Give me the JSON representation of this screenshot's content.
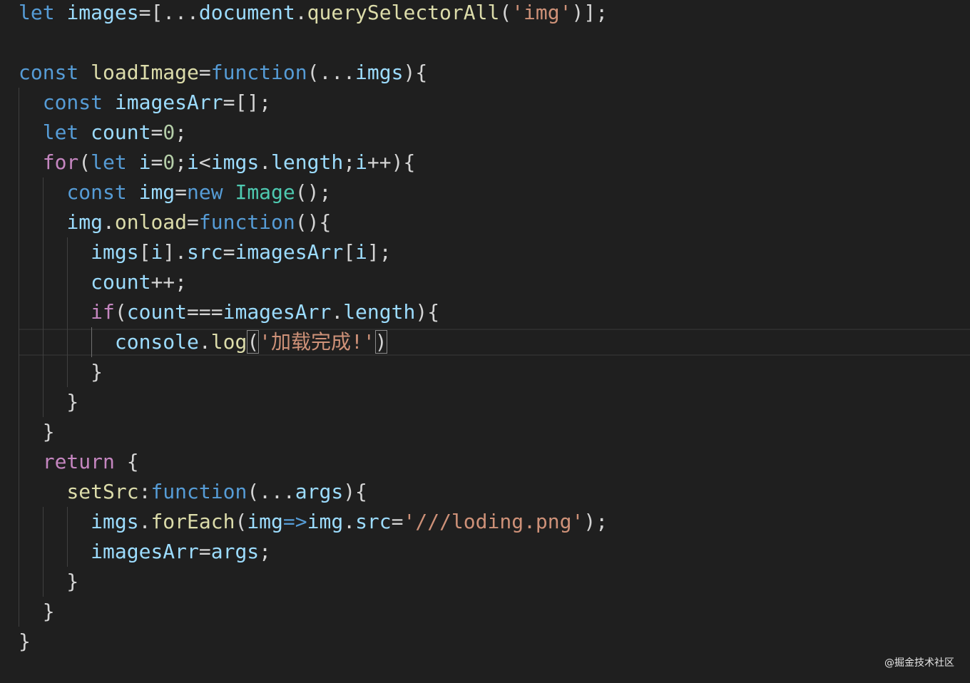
{
  "editor": {
    "lines": [
      [
        [
          "kw",
          "let"
        ],
        [
          "txt",
          " "
        ],
        [
          "var",
          "images"
        ],
        [
          "txt",
          "=[..."
        ],
        [
          "var",
          "document"
        ],
        [
          "txt",
          "."
        ],
        [
          "fn",
          "querySelectorAll"
        ],
        [
          "txt",
          "("
        ],
        [
          "str",
          "'img'"
        ],
        [
          "txt",
          ")];"
        ]
      ],
      [],
      [
        [
          "kw",
          "const"
        ],
        [
          "txt",
          " "
        ],
        [
          "fn",
          "loadImage"
        ],
        [
          "txt",
          "="
        ],
        [
          "kw",
          "function"
        ],
        [
          "txt",
          "(..."
        ],
        [
          "var",
          "imgs"
        ],
        [
          "txt",
          "){"
        ]
      ],
      [
        [
          "txt",
          "  "
        ],
        [
          "kw",
          "const"
        ],
        [
          "txt",
          " "
        ],
        [
          "var",
          "imagesArr"
        ],
        [
          "txt",
          "=[];"
        ]
      ],
      [
        [
          "txt",
          "  "
        ],
        [
          "kw",
          "let"
        ],
        [
          "txt",
          " "
        ],
        [
          "var",
          "count"
        ],
        [
          "txt",
          "="
        ],
        [
          "num",
          "0"
        ],
        [
          "txt",
          ";"
        ]
      ],
      [
        [
          "txt",
          "  "
        ],
        [
          "ctl",
          "for"
        ],
        [
          "txt",
          "("
        ],
        [
          "kw",
          "let"
        ],
        [
          "txt",
          " "
        ],
        [
          "var",
          "i"
        ],
        [
          "txt",
          "="
        ],
        [
          "num",
          "0"
        ],
        [
          "txt",
          ";"
        ],
        [
          "var",
          "i"
        ],
        [
          "txt",
          "<"
        ],
        [
          "var",
          "imgs"
        ],
        [
          "txt",
          "."
        ],
        [
          "var",
          "length"
        ],
        [
          "txt",
          ";"
        ],
        [
          "var",
          "i"
        ],
        [
          "txt",
          "++){"
        ]
      ],
      [
        [
          "txt",
          "    "
        ],
        [
          "kw",
          "const"
        ],
        [
          "txt",
          " "
        ],
        [
          "var",
          "img"
        ],
        [
          "txt",
          "="
        ],
        [
          "kw",
          "new"
        ],
        [
          "txt",
          " "
        ],
        [
          "cls",
          "Image"
        ],
        [
          "txt",
          "();"
        ]
      ],
      [
        [
          "txt",
          "    "
        ],
        [
          "var",
          "img"
        ],
        [
          "txt",
          "."
        ],
        [
          "fn",
          "onload"
        ],
        [
          "txt",
          "="
        ],
        [
          "kw",
          "function"
        ],
        [
          "txt",
          "(){"
        ]
      ],
      [
        [
          "txt",
          "      "
        ],
        [
          "var",
          "imgs"
        ],
        [
          "txt",
          "["
        ],
        [
          "var",
          "i"
        ],
        [
          "txt",
          "]."
        ],
        [
          "var",
          "src"
        ],
        [
          "txt",
          "="
        ],
        [
          "var",
          "imagesArr"
        ],
        [
          "txt",
          "["
        ],
        [
          "var",
          "i"
        ],
        [
          "txt",
          "];"
        ]
      ],
      [
        [
          "txt",
          "      "
        ],
        [
          "var",
          "count"
        ],
        [
          "txt",
          "++;"
        ]
      ],
      [
        [
          "txt",
          "      "
        ],
        [
          "ctl",
          "if"
        ],
        [
          "txt",
          "("
        ],
        [
          "var",
          "count"
        ],
        [
          "txt",
          "==="
        ],
        [
          "var",
          "imagesArr"
        ],
        [
          "txt",
          "."
        ],
        [
          "var",
          "length"
        ],
        [
          "txt",
          "){"
        ]
      ],
      [
        [
          "txt",
          "        "
        ],
        [
          "var",
          "console"
        ],
        [
          "txt",
          "."
        ],
        [
          "fn",
          "log"
        ],
        [
          "txt bracket-match",
          "("
        ],
        [
          "str",
          "'加载完成!'"
        ],
        [
          "txt bracket-match",
          ")"
        ]
      ],
      [
        [
          "txt",
          "      }"
        ]
      ],
      [
        [
          "txt",
          "    }"
        ]
      ],
      [
        [
          "txt",
          "  }"
        ]
      ],
      [
        [
          "txt",
          "  "
        ],
        [
          "ctl",
          "return"
        ],
        [
          "txt",
          " {"
        ]
      ],
      [
        [
          "txt",
          "    "
        ],
        [
          "fn",
          "setSrc"
        ],
        [
          "txt",
          ":"
        ],
        [
          "kw",
          "function"
        ],
        [
          "txt",
          "(..."
        ],
        [
          "var",
          "args"
        ],
        [
          "txt",
          "){"
        ]
      ],
      [
        [
          "txt",
          "      "
        ],
        [
          "var",
          "imgs"
        ],
        [
          "txt",
          "."
        ],
        [
          "fn",
          "forEach"
        ],
        [
          "txt",
          "("
        ],
        [
          "var",
          "img"
        ],
        [
          "kw",
          "=>"
        ],
        [
          "var",
          "img"
        ],
        [
          "txt",
          "."
        ],
        [
          "var",
          "src"
        ],
        [
          "txt",
          "="
        ],
        [
          "str",
          "'///loding.png'"
        ],
        [
          "txt",
          ");"
        ]
      ],
      [
        [
          "txt",
          "      "
        ],
        [
          "var",
          "imagesArr"
        ],
        [
          "txt",
          "="
        ],
        [
          "var",
          "args"
        ],
        [
          "txt",
          ";"
        ]
      ],
      [
        [
          "txt",
          "    }"
        ]
      ],
      [
        [
          "txt",
          "  }"
        ]
      ],
      [
        [
          "txt",
          "}"
        ]
      ]
    ]
  },
  "watermark": "@掘金技术社区"
}
